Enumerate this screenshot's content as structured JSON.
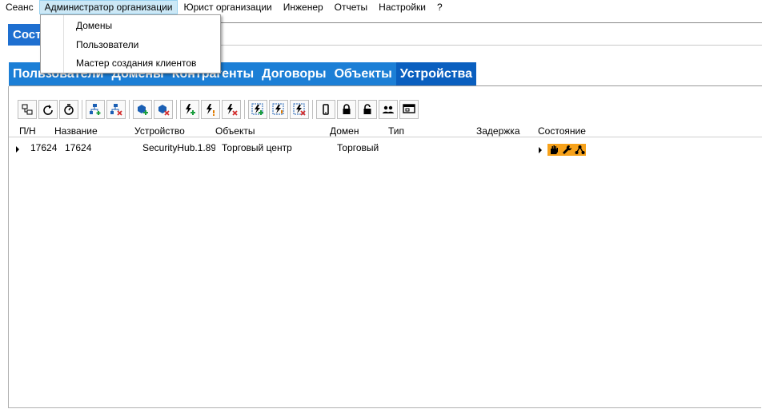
{
  "menubar": {
    "items": [
      "Сеанс",
      "Администратор организации",
      "Юрист организации",
      "Инженер",
      "Отчеты",
      "Настройки",
      "?"
    ]
  },
  "dropdown": {
    "items": [
      "Домены",
      "Пользователи",
      "Мастер создания клиентов"
    ]
  },
  "title_fragment": "Сост",
  "tabs": {
    "items": [
      "Пользователи",
      "Домены",
      "Контрагенты",
      "Договоры",
      "Объекты",
      "Устройства"
    ],
    "active": "Устройства"
  },
  "toolbar": {
    "icons": [
      "network-device-icon",
      "refresh-icon",
      "timer-refresh-icon",
      "add-network-icon",
      "remove-network-icon",
      "add-db-icon",
      "remove-db-icon",
      "add-power-icon",
      "power-warning-icon",
      "remove-power-icon",
      "add-power-group-icon",
      "power-group-warning-icon",
      "remove-power-group-icon",
      "mobile-device-icon",
      "lock-icon",
      "unlock-icon",
      "users-icon",
      "screen-settings-icon"
    ]
  },
  "table": {
    "columns": [
      "П/Н",
      "Название",
      "Устройство",
      "Объекты",
      "Домен",
      "Тип",
      "Задержка",
      "Состояние"
    ],
    "rows": [
      {
        "pn": "17624",
        "name": "17624",
        "device": "SecurityHub.1.89",
        "objects": "Торговый центр",
        "domain": "Торговый",
        "type": "",
        "delay": "",
        "status_icons": [
          "hand-icon",
          "wrench-icon",
          "network-icon"
        ]
      }
    ]
  },
  "colors": {
    "tab_bg": "#1c7fd6",
    "tab_active_bg": "#0a5fbf",
    "status_bg": "#f7a21b",
    "menu_highlight": "#cce8f6"
  }
}
